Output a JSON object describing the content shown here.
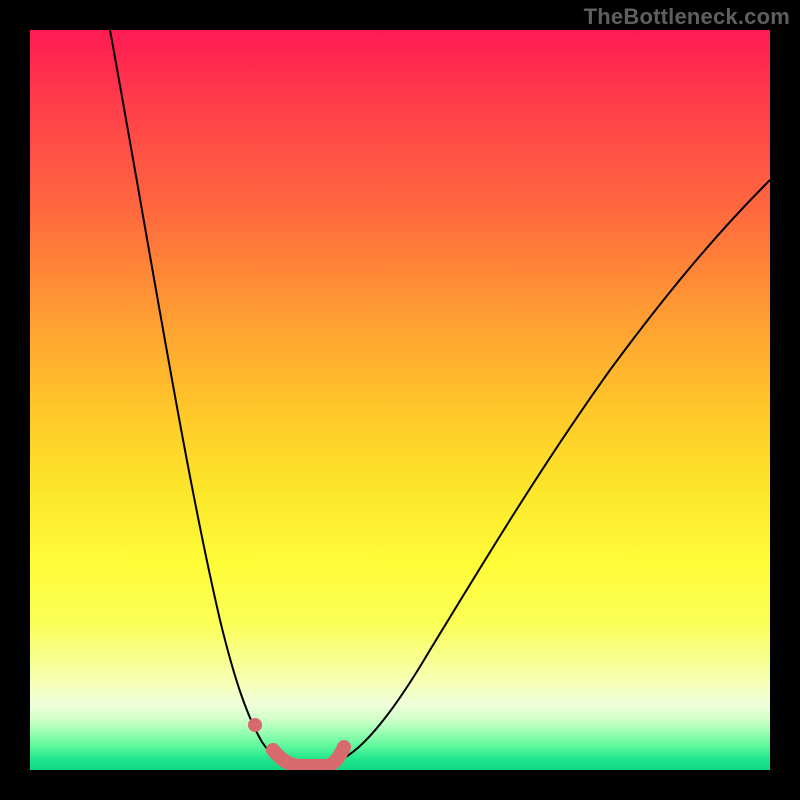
{
  "watermark": "TheBottleneck.com",
  "colors": {
    "marker": "#d86a6e",
    "curve": "#000000",
    "gradient_top": "#ff1a52",
    "gradient_bottom": "#0fd986"
  },
  "chart_data": {
    "type": "line",
    "title": "",
    "xlabel": "",
    "ylabel": "",
    "xlim": [
      0,
      100
    ],
    "ylim": [
      0,
      100
    ],
    "grid": false,
    "legend": false,
    "annotations": [],
    "background_gradient": {
      "orientation": "vertical",
      "stops": [
        {
          "pos": 0,
          "color": "#ff1a52"
        },
        {
          "pos": 25,
          "color": "#ff6a3e"
        },
        {
          "pos": 52,
          "color": "#ffc929"
        },
        {
          "pos": 72,
          "color": "#fffc38"
        },
        {
          "pos": 91,
          "color": "#f1ffd9"
        },
        {
          "pos": 100,
          "color": "#0fd986"
        }
      ]
    },
    "series": [
      {
        "name": "curve-left",
        "color": "#000000",
        "x": [
          11,
          14,
          17,
          20,
          23,
          26,
          29,
          31,
          33,
          34
        ],
        "y": [
          100,
          78,
          58,
          40,
          26,
          15,
          8,
          4,
          2,
          1
        ]
      },
      {
        "name": "curve-right",
        "color": "#000000",
        "x": [
          42,
          46,
          50,
          55,
          62,
          70,
          80,
          90,
          100
        ],
        "y": [
          1,
          4,
          10,
          18,
          30,
          44,
          60,
          72,
          80
        ]
      },
      {
        "name": "marker-trough",
        "color": "#d86a6e",
        "thick": true,
        "x": [
          33,
          35,
          38,
          41,
          43
        ],
        "y": [
          3,
          1,
          0.5,
          1,
          3
        ]
      },
      {
        "name": "marker-dot",
        "color": "#d86a6e",
        "point": true,
        "x": [
          30.5
        ],
        "y": [
          6
        ]
      }
    ]
  }
}
